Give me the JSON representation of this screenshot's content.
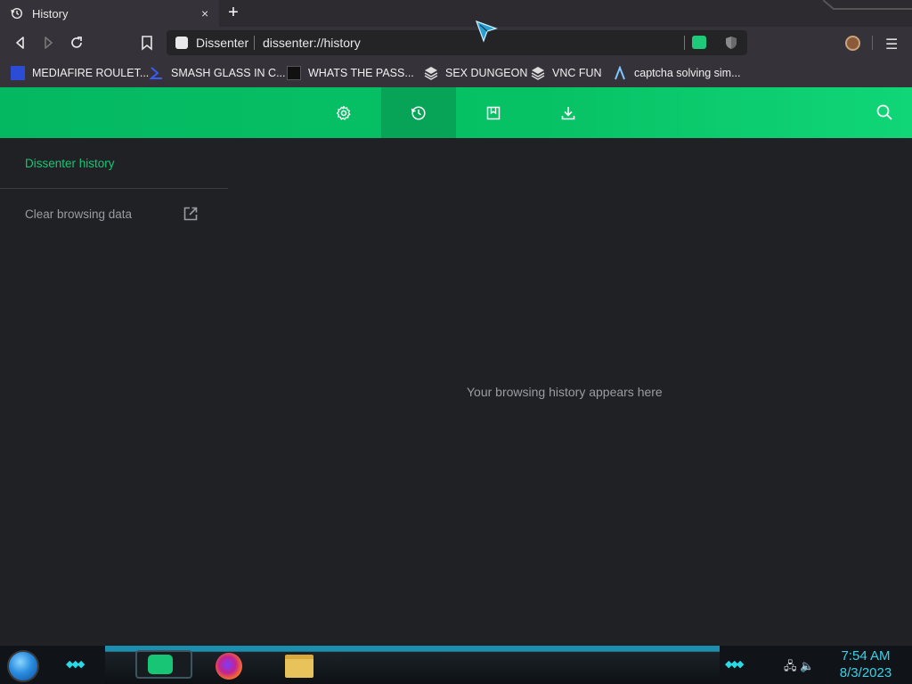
{
  "tab": {
    "title": "History",
    "icon": "history-icon",
    "close": "×"
  },
  "new_tab": "+",
  "toolbar": {
    "back": "back-icon",
    "forward": "forward-icon",
    "reload": "reload-icon",
    "bookmark": "bookmark-icon"
  },
  "omnibox": {
    "site_name": "Dissenter",
    "url": "dissenter://history"
  },
  "bookmarks": [
    {
      "label": "MEDIAFIRE ROULET...",
      "icon": "mediafire-icon"
    },
    {
      "label": "SMASH GLASS IN C...",
      "icon": "sigma-icon"
    },
    {
      "label": "WHATS THE PASS...",
      "icon": "site-icon"
    },
    {
      "label": "SEX DUNGEON",
      "icon": "dungeon-icon"
    },
    {
      "label": "VNC FUN",
      "icon": "vnc-icon"
    },
    {
      "label": "captcha solving sim...",
      "icon": "caret-icon"
    }
  ],
  "nav_tabs": [
    {
      "name": "settings",
      "icon": "gear-icon"
    },
    {
      "name": "history",
      "icon": "history-icon",
      "active": true
    },
    {
      "name": "bookmarks",
      "icon": "bookmark-box-icon"
    },
    {
      "name": "downloads",
      "icon": "download-icon"
    }
  ],
  "sidebar": {
    "title": "Dissenter history",
    "clear_label": "Clear browsing data"
  },
  "main": {
    "empty_message": "Your browsing history appears here"
  },
  "taskbar": {
    "time": "7:54 AM",
    "date": "8/3/2023"
  },
  "colors": {
    "accent": "#07c265",
    "accent_active": "#07a357",
    "sidebar_title": "#17c574",
    "background": "#202124"
  }
}
